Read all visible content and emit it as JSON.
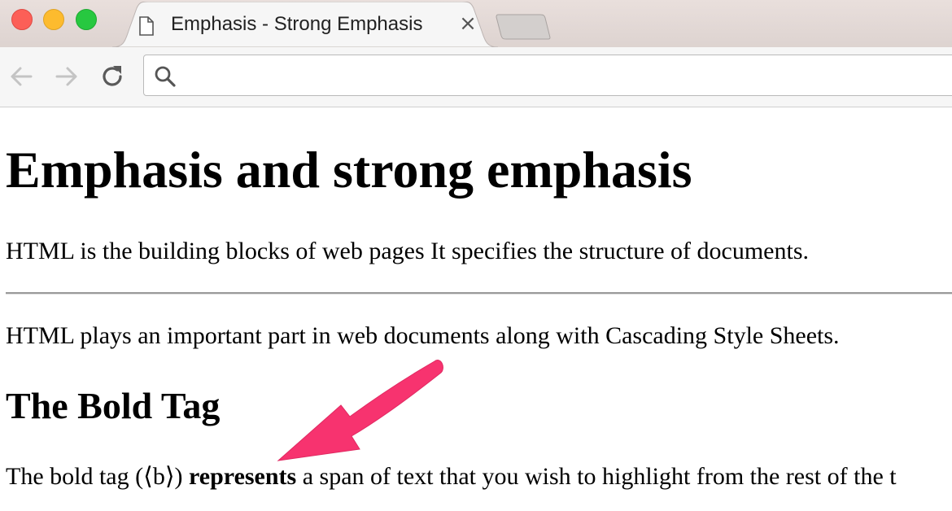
{
  "browser": {
    "tab": {
      "title": "Emphasis - Strong Emphasis",
      "close_glyph": "×",
      "icon": "document-icon"
    },
    "newtab_icon": "new-tab-icon",
    "nav": {
      "back_icon": "back-arrow-icon",
      "forward_icon": "forward-arrow-icon",
      "reload_icon": "reload-icon"
    },
    "omnibox": {
      "value": "",
      "icon": "search-icon"
    },
    "colors": {
      "close": "#fc5f57",
      "minimize": "#fdbb2e",
      "maximize": "#27c840"
    }
  },
  "page": {
    "heading": "Emphasis and strong emphasis",
    "para1": "HTML is the building blocks of web pages It specifies the structure of documents.",
    "para2": "HTML plays an important part in web documents along with Cascading Style Sheets.",
    "subheading": "The Bold Tag",
    "para3_before": "The bold tag (⟨b⟩) ",
    "para3_bold": "represents",
    "para3_after": " a span of text that you wish to highlight from the rest of the t"
  },
  "annotation": {
    "icon": "pink-arrow-icon",
    "color": "#f7336f"
  }
}
